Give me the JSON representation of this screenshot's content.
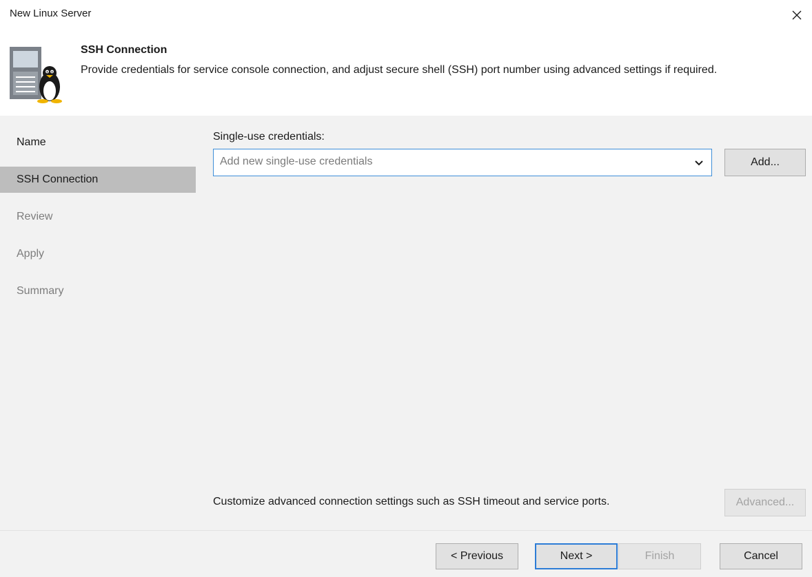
{
  "window": {
    "title": "New Linux Server",
    "close_icon": "close-icon"
  },
  "header": {
    "icon": "linux-server-icon",
    "title": "SSH Connection",
    "description": "Provide credentials for service console connection, and adjust secure shell (SSH) port number using advanced settings if required."
  },
  "steps": [
    {
      "label": "Name",
      "state": "done"
    },
    {
      "label": "SSH Connection",
      "state": "active"
    },
    {
      "label": "Review",
      "state": "pending"
    },
    {
      "label": "Apply",
      "state": "pending"
    },
    {
      "label": "Summary",
      "state": "pending"
    }
  ],
  "credentials": {
    "label": "Single-use credentials:",
    "placeholder": "Add new single-use credentials",
    "add_label": "Add..."
  },
  "advanced": {
    "text": "Customize advanced connection settings such as SSH timeout and service ports.",
    "button_label": "Advanced...",
    "button_enabled": false
  },
  "footer": {
    "previous": "< Previous",
    "next": "Next >",
    "finish": "Finish",
    "cancel": "Cancel"
  },
  "colors": {
    "panel_bg": "#f2f2f2",
    "active_step_bg": "#bdbdbd",
    "focus_border": "#3d8ed8",
    "default_button_border": "#2c7cd6"
  }
}
